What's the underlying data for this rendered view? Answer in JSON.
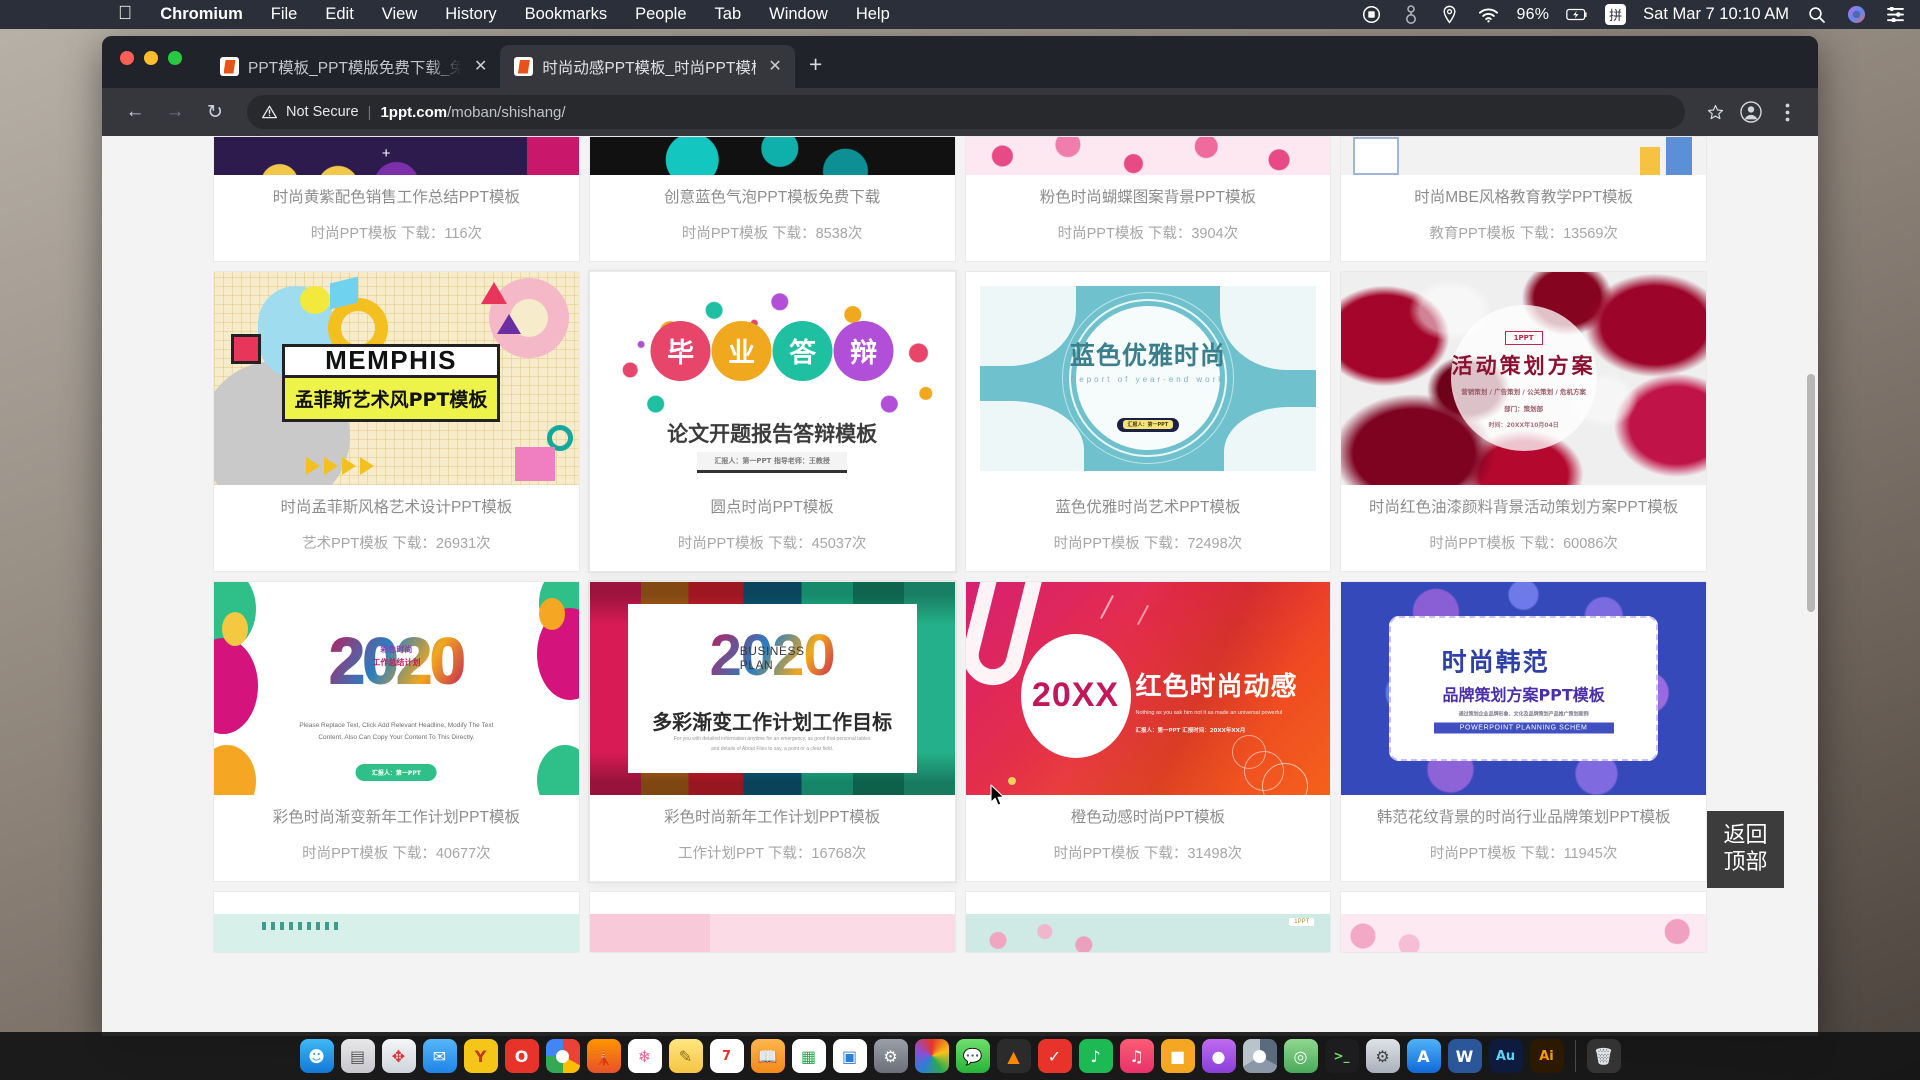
{
  "menubar": {
    "apple_icon": "apple-logo",
    "items": [
      "Chromium",
      "File",
      "Edit",
      "View",
      "History",
      "Bookmarks",
      "People",
      "Tab",
      "Window",
      "Help"
    ],
    "status_icons": [
      "screen-recording-icon",
      "sound-icon",
      "location-icon",
      "wifi-icon"
    ],
    "battery": "96%",
    "battery_icon": "battery-charging-icon",
    "input_method": "拼",
    "datetime": "Sat Mar 7  10:10 AM",
    "search_icon": "spotlight-search-icon",
    "siri_icon": "siri-icon",
    "control_center_icon": "control-center-icon"
  },
  "browser": {
    "tabs": [
      {
        "title": "PPT模板_PPT模版免费下载_免费",
        "favicon": "ppt-favicon",
        "active": false,
        "close_icon": "close-icon"
      },
      {
        "title": "时尚动感PPT模板_时尚PPT模板",
        "favicon": "ppt-favicon",
        "active": true,
        "close_icon": "close-icon"
      }
    ],
    "new_tab_label": "+",
    "toolbar": {
      "back_icon": "back-arrow-icon",
      "forward_icon": "forward-arrow-icon",
      "reload_icon": "reload-icon",
      "security_icon": "warning-triangle-icon",
      "security_label": "Not Secure",
      "url_domain": "1ppt.com",
      "url_path": "/moban/shishang/",
      "bookmark_icon": "star-icon",
      "profile_icon": "account-avatar-icon",
      "menu_icon": "three-dot-menu-icon"
    }
  },
  "page": {
    "back_to_top": {
      "line1": "返回",
      "line2": "顶部"
    },
    "rows": [
      {
        "clipped": true,
        "cards": [
          {
            "title": "时尚黄紫配色销售工作总结PPT模板",
            "meta": "时尚PPT模板  下载：116次",
            "art": "purple-yellow"
          },
          {
            "title": "创意蓝色气泡PPT模板免费下载",
            "meta": "时尚PPT模板  下载：8538次",
            "art": "teal-bubble"
          },
          {
            "title": "粉色时尚蝴蝶图案背景PPT模板",
            "meta": "时尚PPT模板  下载：3904次",
            "art": "pink-butterfly"
          },
          {
            "title": "时尚MBE风格教育教学PPT模板",
            "meta": "教育PPT模板  下载：13569次",
            "art": "mbe-edu"
          }
        ]
      },
      {
        "clipped": false,
        "cards": [
          {
            "title": "时尚孟菲斯风格艺术设计PPT模板",
            "meta": "艺术PPT模板  下载：26931次",
            "art": "memphis",
            "art_text": {
              "main": "MEMPHIS",
              "sub": "孟菲斯艺术风PPT模板"
            }
          },
          {
            "title": "圆点时尚PPT模板",
            "meta": "时尚PPT模板  下载：45037次",
            "art": "dots",
            "art_text": {
              "circles": [
                "毕",
                "业",
                "答",
                "辩"
              ],
              "sub": "论文开题报告答辩模板",
              "footer": "汇报人：第一PPT    指导老师：王教授"
            }
          },
          {
            "title": "蓝色优雅时尚艺术PPT模板",
            "meta": "时尚PPT模板  下载：72498次",
            "art": "blue-elegant",
            "art_text": {
              "main": "蓝色优雅时尚",
              "sub": "Report of year-end work",
              "badge": "汇报人：第一PPT"
            }
          },
          {
            "title": "时尚红色油漆颜料背景活动策划方案PPT模板",
            "meta": "时尚PPT模板  下载：60086次",
            "art": "red-ink",
            "art_text": {
              "tag": "1PPT",
              "main": "活动策划方案",
              "sub": "营销策划 / 广告策划 / 公关策划 / 危机方案",
              "line3": "部门：策划部",
              "line4": "时间：20XX年10月04日"
            }
          }
        ]
      },
      {
        "clipped": false,
        "cards": [
          {
            "title": "彩色时尚渐变新年工作计划PPT模板",
            "meta": "时尚PPT模板  下载：40677次",
            "art": "colorful-2020",
            "art_text": {
              "year": "2020",
              "badge1": "彩色时尚",
              "badge2": "工作总结计划",
              "body": "Please Replace Text, Click Add Relevant Headline, Modify The Text Content, Also Can Copy Your Content To This Directly.",
              "button": "汇报人：第一PPT"
            }
          },
          {
            "title": "彩色时尚新年工作计划PPT模板",
            "meta": "工作计划PPT  下载：16768次",
            "art": "stripe-2020",
            "art_text": {
              "year": "2020",
              "sub1": "BUSINESS",
              "sub2": "PLAN",
              "main": "多彩渐变工作计划工作目标",
              "body": "For you with detailed information anytime for an emergency, as good that personal tables and details of About Files to say, a point or a clear field."
            }
          },
          {
            "title": "橙色动感时尚PPT模板",
            "meta": "时尚PPT模板  下载：31498次",
            "art": "red-dynamic",
            "art_text": {
              "year": "20XX",
              "main": "红色时尚动感",
              "sub": "Nothing as you ask him not it as made an universal powerful",
              "footer": "汇报人：第一PPT    汇报时间：20XX年XX月"
            }
          },
          {
            "title": "韩范花纹背景的时尚行业品牌策划PPT模板",
            "meta": "时尚PPT模板  下载：11945次",
            "art": "korean-floral",
            "art_text": {
              "main": "时尚韩范",
              "sub": "品牌策划方案PPT模板",
              "body": "通过策划企业品牌形象、文化及品牌策划产品推广策划案例",
              "footer": "POWERPOINT  PLANNING SCHEM"
            }
          }
        ]
      },
      {
        "clipped": true,
        "cards": [
          {
            "title": "",
            "meta": "",
            "art": "mint-bottom"
          },
          {
            "title": "",
            "meta": "",
            "art": "pink-bottom"
          },
          {
            "title": "",
            "meta": "",
            "art": "sakura-bottom"
          },
          {
            "title": "",
            "meta": "",
            "art": "floral-bottom"
          }
        ]
      }
    ]
  },
  "dock": {
    "items": [
      "finder-icon",
      "launchpad-icon",
      "safari-icon",
      "mail-icon",
      "yandex-icon",
      "opera-icon",
      "chrome-icon",
      "firefox-icon",
      "photos-icon",
      "notes-icon",
      "calendar-icon",
      "books-icon",
      "numbers-icon",
      "keynote-icon",
      "preferences-icon",
      "colorsync-icon",
      "messages-icon",
      "vlc-icon",
      "todo-icon",
      "spotify-icon",
      "music-icon",
      "store-icon",
      "podcasts-icon",
      "chromium-icon",
      "maps-icon",
      "terminal-icon",
      "system-icon",
      "appstore-icon",
      "word-icon",
      "au-icon",
      "ai-icon",
      "trash-icon"
    ],
    "labels": {
      "au": "Au",
      "ai": "Ai"
    }
  }
}
